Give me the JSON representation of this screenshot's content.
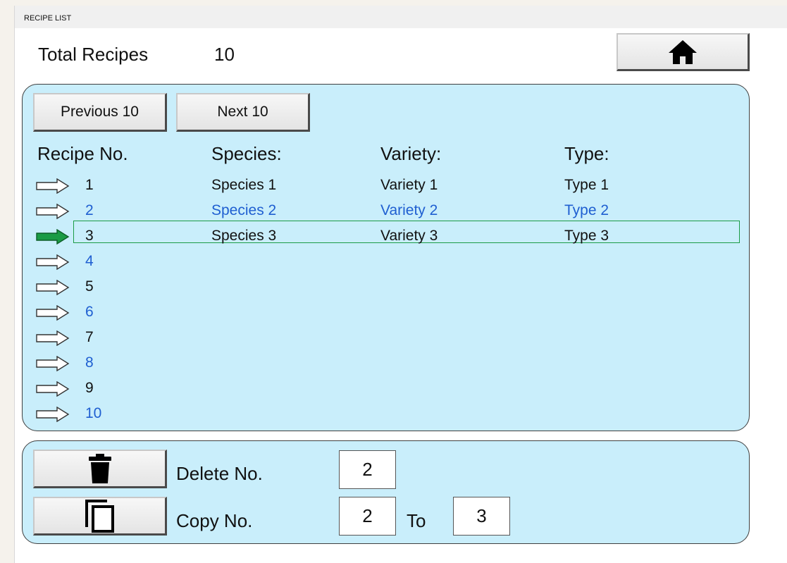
{
  "window": {
    "title": "RECIPE LIST"
  },
  "header": {
    "total_label": "Total Recipes",
    "total_value": "10",
    "home_icon": "home-icon"
  },
  "nav": {
    "previous_label": "Previous 10",
    "next_label": "Next 10"
  },
  "table": {
    "columns": [
      "Recipe No.",
      "Species:",
      "Variety:",
      "Type:"
    ],
    "selected_index": 3,
    "rows": [
      {
        "no": "1",
        "species": "Species 1",
        "variety": "Variety 1",
        "type": "Type 1"
      },
      {
        "no": "2",
        "species": "Species 2",
        "variety": "Variety 2",
        "type": "Type 2"
      },
      {
        "no": "3",
        "species": "Species 3",
        "variety": "Variety 3",
        "type": "Type 3"
      },
      {
        "no": "4",
        "species": "",
        "variety": "",
        "type": ""
      },
      {
        "no": "5",
        "species": "",
        "variety": "",
        "type": ""
      },
      {
        "no": "6",
        "species": "",
        "variety": "",
        "type": ""
      },
      {
        "no": "7",
        "species": "",
        "variety": "",
        "type": ""
      },
      {
        "no": "8",
        "species": "",
        "variety": "",
        "type": ""
      },
      {
        "no": "9",
        "species": "",
        "variety": "",
        "type": ""
      },
      {
        "no": "10",
        "species": "",
        "variety": "",
        "type": ""
      }
    ]
  },
  "actions": {
    "delete_label": "Delete No.",
    "delete_value": "2",
    "copy_label": "Copy No.",
    "copy_from": "2",
    "to_label": "To",
    "copy_to": "3",
    "delete_icon": "trash-icon",
    "copy_icon": "copy-icon"
  },
  "colors": {
    "panel": "#c9eefb",
    "alt_row_text": "#1f5fd1",
    "selected_arrow": "#1a9b45"
  }
}
